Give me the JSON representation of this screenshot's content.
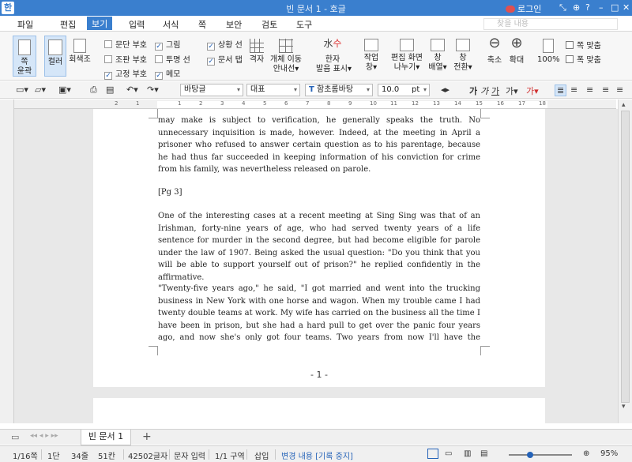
{
  "app": {
    "title": "빈 문서 1 - 호글",
    "login": "로그인",
    "icon_label": "한",
    "window_buttons": [
      "⤡",
      "⊕",
      "?",
      "–",
      "□",
      "✕"
    ]
  },
  "menu": {
    "items": [
      "파일",
      "편집",
      "보기",
      "입력",
      "서식",
      "쪽",
      "보안",
      "검토",
      "도구"
    ],
    "active": "보기",
    "search_placeholder": "찾을 내용"
  },
  "ribbon": {
    "big": [
      {
        "label": "쪽\n윤곽"
      },
      {
        "label": "컬러"
      },
      {
        "label": "회색조"
      }
    ],
    "checks_col1": [
      {
        "label": "문단 부호",
        "checked": false
      },
      {
        "label": "조판 부호",
        "checked": false
      },
      {
        "label": "고정 부호",
        "checked": true
      }
    ],
    "checks_col2": [
      {
        "label": "그림",
        "checked": true
      },
      {
        "label": "투명 선",
        "checked": false
      },
      {
        "label": "메모",
        "checked": true
      }
    ],
    "checks_col3": [
      {
        "label": "상황 선",
        "checked": true
      },
      {
        "label": "문서 탭",
        "checked": true
      }
    ],
    "buttons": [
      {
        "label": "격자"
      },
      {
        "label": "개체 이동\n안내선"
      },
      {
        "label": "한자\n발음 표시"
      },
      {
        "label": "작업\n창"
      },
      {
        "label": "편집 화면\n나누기"
      },
      {
        "label": "창\n배열"
      },
      {
        "label": "창\n전환"
      },
      {
        "label": "축소"
      },
      {
        "label": "확대"
      },
      {
        "label": "100%"
      }
    ],
    "fit": [
      "쪽 맞춤",
      "폭 맞춤"
    ]
  },
  "format": {
    "style": "바탕글",
    "lang": "대표",
    "font": "함초롬바탕",
    "size": "10.0",
    "unit": "pt",
    "char_buttons": [
      "가",
      "가",
      "가"
    ]
  },
  "ruler": {
    "ticks": [
      "2",
      "1",
      "",
      "1",
      "2",
      "3",
      "4",
      "5",
      "6",
      "7",
      "8",
      "9",
      "10",
      "11",
      "12",
      "13",
      "14",
      "15",
      "16",
      "17",
      "18"
    ]
  },
  "document": {
    "paragraphs": [
      "may make is subject to verification, he generally speaks the truth. No unnecessary inquisition is made, however. Indeed, at the meeting in April a prisoner who refused to answer certain question as to his parentage, because he had thus far succeeded in keeping information of his conviction for crime from his family, was nevertheless released on parole.",
      "[Pg 3]",
      "One of the interesting cases at a recent meeting at Sing Sing was that of an Irishman, forty-nine years of age, who had served twenty years of a life sentence for murder in the second degree, but had become eligible for parole under the law of 1907. Being asked the usual question: \"Do you think that you will be able to support yourself out of prison?\" he replied confidently in the affirmative.",
      "\"Twenty-five years ago,\" he said, \"I got married and went into the trucking business in New York with one horse and wagon. When my trouble came I had twenty double teams at work. My wife has carried on the business all the time I have been in prison, but she had a hard pull to get over the panic four years ago, and now she's only got four teams. Two years from now I'll have the twenty"
    ],
    "page_number": "- 1 -"
  },
  "tabs": {
    "doc_tab": "빈 문서 1",
    "add": "+"
  },
  "status": {
    "page": "1/16쪽",
    "section": "1단",
    "line": "34줄",
    "col": "51칸",
    "chars": "42502글자",
    "mode": "문자 입력",
    "area": "1/1 구역",
    "insert": "삽입",
    "track": "변경 내용 [기록 중지]",
    "zoom": "95%"
  }
}
